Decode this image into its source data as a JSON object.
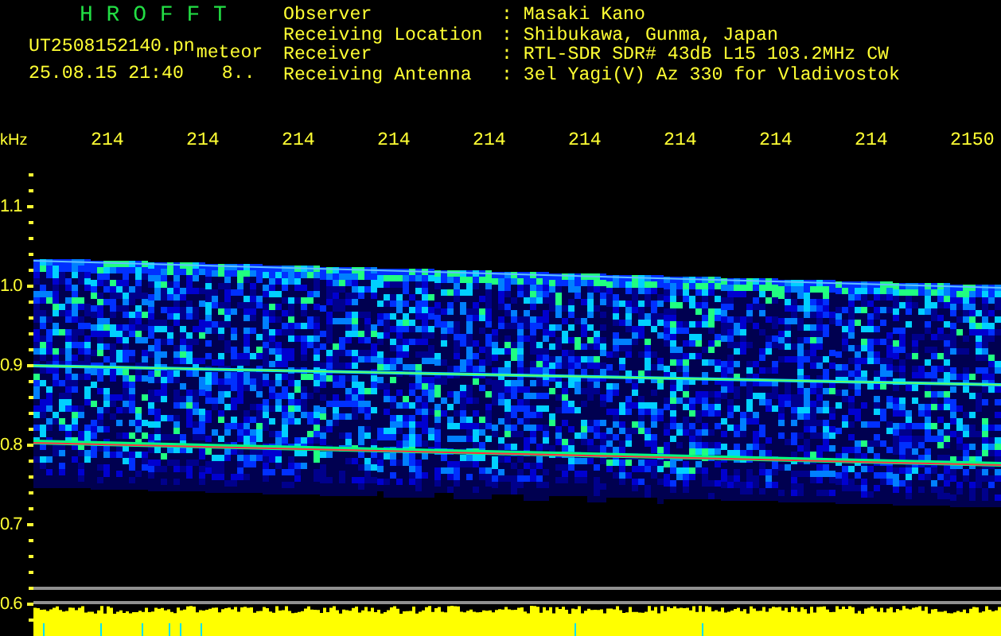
{
  "title": "H R O F F T",
  "file": {
    "name": "UT2508152140.pn",
    "tag": "meteor"
  },
  "timestamp": "25.08.15 21:40",
  "count": "8..",
  "info": [
    {
      "label": "Observer",
      "value": ": Masaki Kano"
    },
    {
      "label": "Receiving Location",
      "value": ": Shibukawa, Gunma, Japan"
    },
    {
      "label": "Receiver",
      "value": ": RTL-SDR SDR# 43dB L15 103.2MHz CW"
    },
    {
      "label": "Receiving Antenna",
      "value": ": 3el Yagi(V) Az 330 for Vladivostok"
    }
  ],
  "x_axis": {
    "unit": "kHz",
    "ticks": [
      "214",
      "214",
      "214",
      "214",
      "214",
      "214",
      "214",
      "214",
      "214",
      "2150"
    ]
  },
  "y_axis": {
    "ticks": [
      "1.1",
      "1.0",
      "0.9",
      "0.8",
      "0.7",
      "0.6"
    ]
  }
}
